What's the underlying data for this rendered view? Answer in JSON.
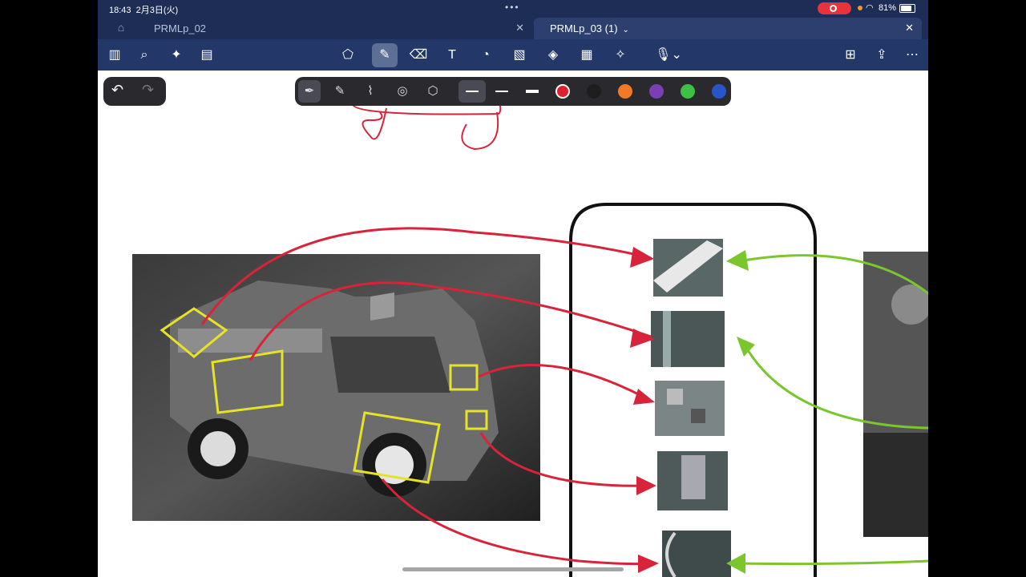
{
  "status": {
    "time": "18:43",
    "date": "2月3日(火)",
    "battery": "81%"
  },
  "tabs": [
    {
      "label": "PRMLp_02",
      "active": false
    },
    {
      "label": "PRMLp_03 (1)",
      "active": true
    }
  ],
  "toolbar_left": [
    "sidebar-icon",
    "search-icon",
    "ai-sparkle-icon",
    "notes-icon"
  ],
  "toolbar_center": [
    "lasso-icon",
    "pen-icon",
    "eraser-icon",
    "textbox-icon",
    "shapes-icon",
    "image-icon",
    "elements-icon",
    "sticky-note-icon",
    "laser-icon",
    "dictation-icon"
  ],
  "toolbar_right": [
    "add-page-icon",
    "share-icon",
    "more-icon"
  ],
  "palette": {
    "tools": [
      "fountain-pen-icon",
      "ballpoint-pen-icon",
      "highlighter-icon",
      "shape-pen-icon",
      "lasso-pen-icon"
    ],
    "colors": [
      "#e0202e",
      "#1e1e1e",
      "#f07a26",
      "#7a3fb3",
      "#3cc144",
      "#2a55c8"
    ],
    "selected_color": "#e0202e"
  },
  "colors": {
    "annotation_red": "#d8243a",
    "annotation_green": "#7ac62c",
    "box_yellow": "#e6e22a",
    "chrome": "#1d2d55"
  }
}
